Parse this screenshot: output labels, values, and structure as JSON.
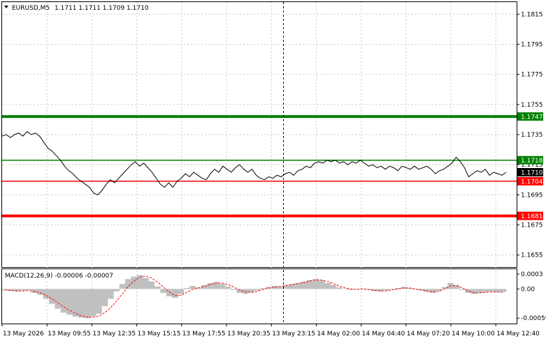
{
  "header": {
    "symbol": "EURUSD,M5",
    "ohlc": "1.1711 1.1711 1.1709 1.1710"
  },
  "macd": {
    "label": "MACD(12,26,9) -0.00006 -0.00007",
    "ticks": [
      "0.0003",
      "0.00",
      "-0.00059"
    ]
  },
  "chart_data": {
    "type": "line",
    "price_ticks": [
      "1.1815",
      "1.1795",
      "1.1775",
      "1.1755",
      "1.1735",
      "1.1715",
      "1.1695",
      "1.1675",
      "1.1655"
    ],
    "price_ylim": [
      1.1647,
      1.1823
    ],
    "x_labels": [
      "13 May 2026",
      "13 May 09:55",
      "13 May 12:35",
      "13 May 15:15",
      "13 May 17:55",
      "13 May 20:35",
      "13 May 23:15",
      "14 May 02:00",
      "14 May 04:40",
      "14 May 07:20",
      "14 May 10:00",
      "14 May 12:40"
    ],
    "levels": [
      {
        "value": 1.1747,
        "label": "1.1747",
        "color": "#008000",
        "weight": "thick"
      },
      {
        "value": 1.1718,
        "label": "1.1718",
        "color": "#008000",
        "weight": "thin"
      },
      {
        "value": 1.1704,
        "label": "1.1704",
        "color": "#ff0000",
        "weight": "thin"
      },
      {
        "value": 1.1681,
        "label": "1.1681",
        "color": "#ff0000",
        "weight": "thick"
      }
    ],
    "current_price": "1.1710",
    "price_series": [
      1.1734,
      1.1735,
      1.1733,
      1.1735,
      1.1736,
      1.1734,
      1.1737,
      1.1735,
      1.1736,
      1.1734,
      1.173,
      1.1726,
      1.1724,
      1.1721,
      1.1718,
      1.1714,
      1.1711,
      1.1709,
      1.1706,
      1.1704,
      1.1702,
      1.17,
      1.1696,
      1.1695,
      1.1698,
      1.1702,
      1.1705,
      1.1703,
      1.1706,
      1.1709,
      1.1712,
      1.1715,
      1.1717,
      1.1714,
      1.1716,
      1.1713,
      1.171,
      1.1706,
      1.1702,
      1.17,
      1.1703,
      1.17,
      1.1704,
      1.1706,
      1.1709,
      1.1707,
      1.171,
      1.1708,
      1.1706,
      1.1705,
      1.1709,
      1.1712,
      1.171,
      1.1714,
      1.1712,
      1.171,
      1.1713,
      1.1715,
      1.1712,
      1.171,
      1.1712,
      1.1708,
      1.1706,
      1.1705,
      1.1707,
      1.1706,
      1.1708,
      1.1707,
      1.1709,
      1.171,
      1.1708,
      1.1711,
      1.1712,
      1.1714,
      1.1713,
      1.1716,
      1.1717,
      1.1716,
      1.1718,
      1.1717,
      1.1718,
      1.1716,
      1.1717,
      1.1715,
      1.1717,
      1.1716,
      1.1718,
      1.1716,
      1.1714,
      1.1715,
      1.1713,
      1.1714,
      1.1712,
      1.1714,
      1.1713,
      1.1711,
      1.1714,
      1.1713,
      1.1712,
      1.1714,
      1.1712,
      1.1713,
      1.1714,
      1.1712,
      1.1709,
      1.1711,
      1.1712,
      1.1714,
      1.1716,
      1.172,
      1.1717,
      1.1713,
      1.1707,
      1.1709,
      1.1711,
      1.171,
      1.1712,
      1.1708,
      1.171,
      1.1709,
      1.1708,
      1.171
    ],
    "macd_ylim": [
      -0.0007,
      0.0004
    ],
    "macd_hist": [
      -3e-05,
      -4e-05,
      -5e-05,
      -3e-05,
      -2e-05,
      -8e-05,
      -0.00012,
      -0.0002,
      -0.0003,
      -0.0004,
      -0.00048,
      -0.00052,
      -0.00056,
      -0.00058,
      -0.00059,
      -0.00055,
      -0.0005,
      -0.00035,
      -0.0002,
      -5e-05,
      0.0001,
      0.0002,
      0.00025,
      0.00028,
      0.00022,
      0.00015,
      5e-05,
      -8e-05,
      -0.00015,
      -0.00018,
      -0.0001,
      2e-05,
      6e-05,
      3e-05,
      8e-05,
      0.00012,
      0.00014,
      0.0001,
      5e-05,
      -2e-05,
      -8e-05,
      -0.0001,
      -7e-05,
      -3e-05,
      2e-05,
      4e-05,
      6e-05,
      5e-05,
      8e-05,
      0.0001,
      0.00012,
      0.00015,
      0.00018,
      0.0002,
      0.00018,
      0.00012,
      8e-05,
      3e-05,
      0.0,
      -2e-05,
      -1e-05,
      1e-05,
      -2e-05,
      -4e-05,
      -5e-05,
      -3e-05,
      -1e-05,
      2e-05,
      4e-05,
      2e-05,
      -1e-05,
      -3e-05,
      -6e-05,
      -8e-05,
      -4e-05,
      4e-05,
      0.00012,
      8e-05,
      -2e-05,
      -8e-05,
      -0.0001,
      -8e-05,
      -6e-05,
      -5e-05,
      -6e-05,
      -6e-05
    ],
    "macd_signal": [
      -2e-05,
      -3e-05,
      -4e-05,
      -4e-05,
      -3e-05,
      -5e-05,
      -8e-05,
      -0.00013,
      -0.0002,
      -0.00028,
      -0.00036,
      -0.00043,
      -0.00049,
      -0.00054,
      -0.00057,
      -0.00057,
      -0.00055,
      -0.00048,
      -0.00038,
      -0.00025,
      -0.0001,
      5e-05,
      0.00016,
      0.00024,
      0.00026,
      0.00022,
      0.00014,
      4e-05,
      -6e-05,
      -0.00013,
      -0.00013,
      -7e-05,
      -1e-05,
      2e-05,
      5e-05,
      9e-05,
      0.00012,
      0.00012,
      9e-05,
      4e-05,
      -2e-05,
      -6e-05,
      -7e-05,
      -5e-05,
      -1e-05,
      2e-05,
      4e-05,
      5e-05,
      7e-05,
      9e-05,
      0.00011,
      0.00013,
      0.00016,
      0.00018,
      0.00018,
      0.00015,
      0.00011,
      6e-05,
      2e-05,
      0.0,
      -1e-05,
      0.0,
      -1e-05,
      -3e-05,
      -4e-05,
      -4e-05,
      -2e-05,
      0.0,
      2e-05,
      2e-05,
      0.0,
      -2e-05,
      -4e-05,
      -6e-05,
      -5e-05,
      0.0,
      6e-05,
      7e-05,
      2e-05,
      -4e-05,
      -8e-05,
      -8e-05,
      -7e-05,
      -6e-05,
      -6e-05,
      -7e-05
    ]
  },
  "colors": {
    "grid": "#c8c8c8",
    "price_line": "#000000",
    "macd_hist": "#c0c0c0",
    "macd_signal": "#ff0000",
    "cursor": "#000000"
  }
}
